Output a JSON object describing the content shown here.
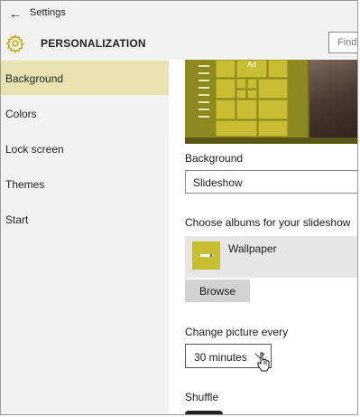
{
  "titlebar": {
    "back_icon": "back-arrow-icon",
    "title": "Settings"
  },
  "header": {
    "icon": "gear-icon",
    "title": "PERSONALIZATION",
    "search_placeholder": "Find"
  },
  "sidebar": {
    "items": [
      {
        "label": "Background",
        "active": true
      },
      {
        "label": "Colors",
        "active": false
      },
      {
        "label": "Lock screen",
        "active": false
      },
      {
        "label": "Themes",
        "active": false
      },
      {
        "label": "Start",
        "active": false
      }
    ]
  },
  "preview": {
    "tile_text": "Ad"
  },
  "background": {
    "label": "Background",
    "value": "Slideshow"
  },
  "albums": {
    "label": "Choose albums for your slideshow",
    "items": [
      {
        "name": "Wallpaper",
        "icon": "album-folder-icon"
      }
    ],
    "browse_label": "Browse"
  },
  "interval": {
    "label": "Change picture every",
    "value": "30 minutes",
    "icon": "chevron-down-icon"
  },
  "shuffle": {
    "label": "Shuffle"
  },
  "colors": {
    "accent": "#c8be34",
    "active_nav": "#e8e2b0",
    "chrome": "#f2f2f2"
  }
}
